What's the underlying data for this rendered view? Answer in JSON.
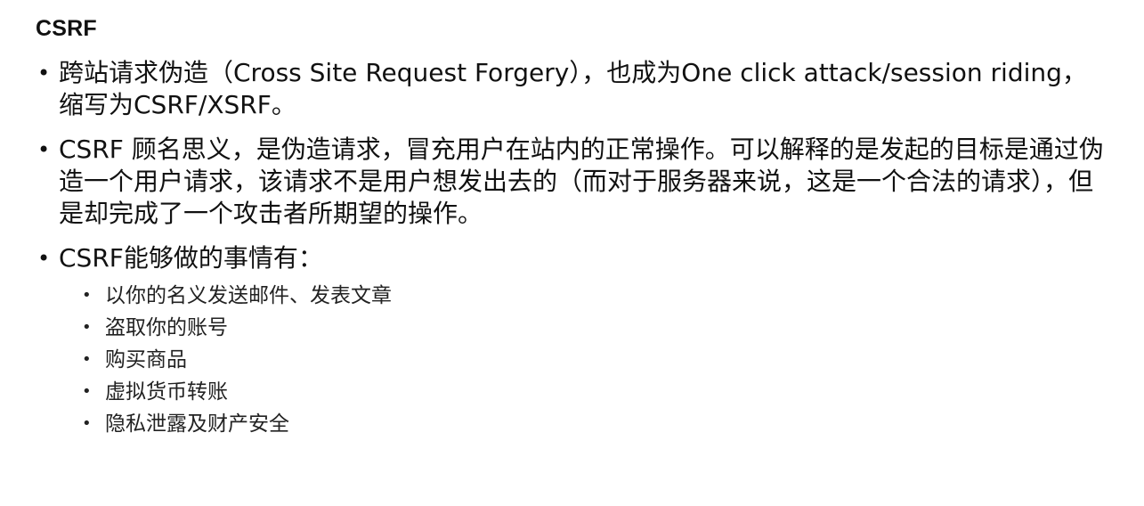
{
  "slide": {
    "title": "CSRF",
    "bullet_glyph": "•",
    "bullets": [
      {
        "text": "跨站请求伪造（Cross Site Request Forgery），也成为One click attack/session riding，缩写为CSRF/XSRF。"
      },
      {
        "text": "CSRF 顾名思义，是伪造请求，冒充用户在站内的正常操作。可以解释的是发起的目标是通过伪造一个用户请求，该请求不是用户想发出去的（而对于服务器来说，这是一个合法的请求），但是却完成了一个攻击者所期望的操作。"
      },
      {
        "text": "CSRF能够做的事情有："
      }
    ],
    "sub_bullets": [
      {
        "text": "以你的名义发送邮件、发表文章"
      },
      {
        "text": "盗取你的账号"
      },
      {
        "text": "购买商品"
      },
      {
        "text": "虚拟货币转账"
      },
      {
        "text": "隐私泄露及财产安全"
      }
    ]
  }
}
